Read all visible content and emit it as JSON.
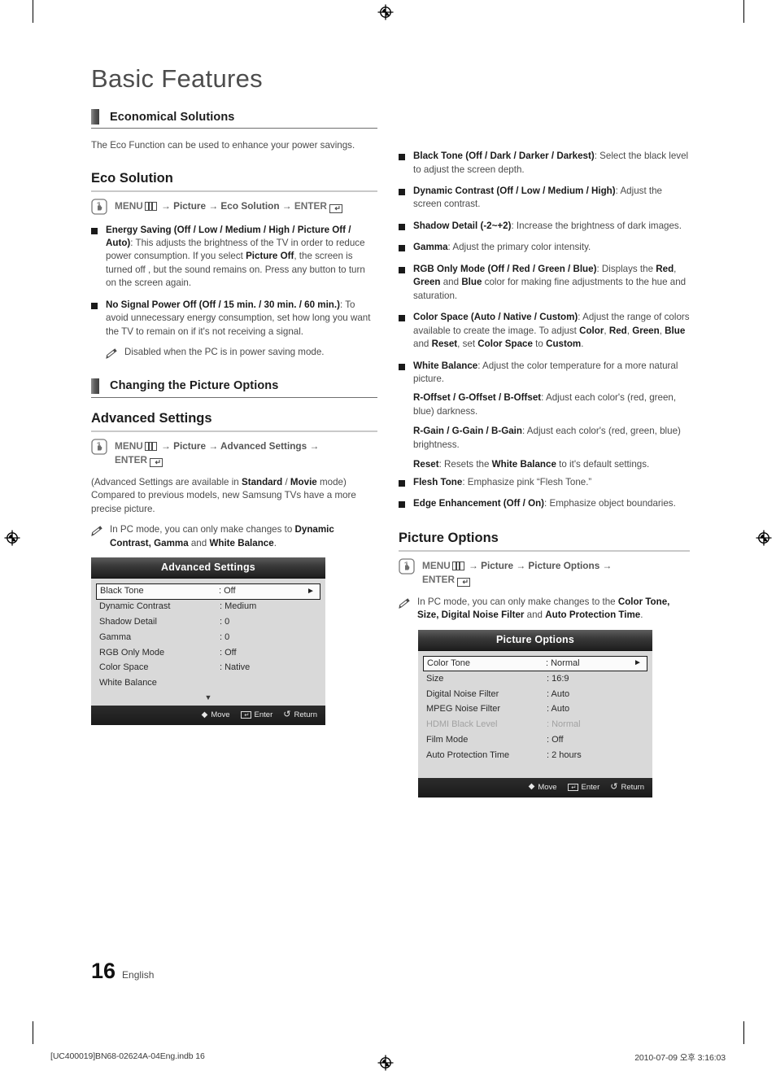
{
  "document": {
    "title": "Basic Features",
    "page_number": "16",
    "language_label": "English",
    "print_file": "[UC400019]BN68-02624A-04Eng.indb   16",
    "print_timestamp": "2010-07-09   오후 3:16:03"
  },
  "left_column": {
    "section_1": {
      "heading": "Economical Solutions",
      "intro": "The Eco Function can be used to enhance your power savings."
    },
    "eco_solution": {
      "heading": "Eco Solution",
      "menu_path_prefix": "MENU",
      "menu_path_mid": " → Picture → Eco  Solution → ",
      "menu_path_enter": "ENTER",
      "bullets": [
        {
          "term": "Energy Saving (Off / Low / Medium / High /  Picture Off / Auto)",
          "desc": ": This adjusts the brightness of the TV in order to reduce power consumption. If you select ",
          "bold_mid": "Picture Off",
          "desc2": ", the screen is turned off , but the sound remains on. Press any button to turn on the screen again."
        },
        {
          "term": "No Signal Power Off (Off / 15 min. / 30 min. / 60 min.)",
          "desc": ": To avoid unnecessary energy consumption, set how long you want the TV to remain on if it's not receiving a signal.",
          "note": "Disabled when the PC is in power saving mode."
        }
      ]
    },
    "section_2": {
      "heading": "Changing the Picture Options"
    },
    "advanced_settings": {
      "heading": "Advanced Settings",
      "menu_path_prefix": "MENU",
      "menu_path_mid": " → Picture → Advanced Settings → ",
      "menu_path_enter": "ENTER",
      "para_1_a": "(Advanced Settings are available in ",
      "para_1_b": "Standard",
      "para_1_c": " / ",
      "para_1_d": "Movie",
      "para_1_e": " mode) Compared to previous models, new Samsung TVs have a more precise picture.",
      "note_a": "In PC mode, you can only make changes to ",
      "note_b": "Dynamic Contrast, Gamma",
      "note_c": " and ",
      "note_d": "White Balance",
      "note_e": "."
    },
    "osd_advanced": {
      "title": "Advanced Settings",
      "rows": [
        {
          "label": "Black Tone",
          "value": ": Off",
          "selected": true,
          "arrow": "►"
        },
        {
          "label": "Dynamic Contrast",
          "value": ": Medium",
          "selected": false
        },
        {
          "label": "Shadow Detail",
          "value": ": 0",
          "selected": false
        },
        {
          "label": "Gamma",
          "value": ": 0",
          "selected": false
        },
        {
          "label": "RGB Only Mode",
          "value": ": Off",
          "selected": false
        },
        {
          "label": "Color Space",
          "value": ": Native",
          "selected": false
        },
        {
          "label": "White Balance",
          "value": "",
          "selected": false
        }
      ],
      "more_indicator": "▼",
      "footer": {
        "move": "Move",
        "enter": "Enter",
        "return": "Return"
      }
    }
  },
  "right_column": {
    "advanced_bullets": [
      {
        "term": "Black Tone (Off / Dark / Darker / Darkest)",
        "desc": ": Select the black level to adjust the screen depth."
      },
      {
        "term": "Dynamic Contrast (Off / Low / Medium / High)",
        "desc": ": Adjust the screen contrast."
      },
      {
        "term": "Shadow Detail (-2~+2)",
        "desc": ": Increase the brightness of dark images."
      },
      {
        "term": "Gamma",
        "desc": ": Adjust the primary color intensity."
      },
      {
        "term": "RGB Only Mode (Off / Red / Green / Blue)",
        "desc": ": Displays the Red, Green and Blue color for making fine adjustments to the hue and saturation."
      },
      {
        "term": "Color Space (Auto / Native / Custom)",
        "desc": ": Adjust the range of colors available to create the image. To adjust Color, Red, Green, Blue and Reset, set Color Space to Custom."
      },
      {
        "term": "White Balance",
        "desc": ": Adjust the color temperature for a more natural picture."
      },
      {
        "term": "Flesh Tone",
        "desc": ": Emphasize pink “Flesh Tone.”"
      },
      {
        "term": "Edge Enhancement (Off / On)",
        "desc": ": Emphasize object boundaries."
      }
    ],
    "white_balance_subs": [
      {
        "term": "R-Offset / G-Offset / B-Offset",
        "desc": ": Adjust each color's (red, green, blue) darkness."
      },
      {
        "term": "R-Gain / G-Gain / B-Gain",
        "desc": ": Adjust each color's (red, green, blue) brightness."
      },
      {
        "term": "Reset",
        "desc_a": ": Resets the ",
        "desc_b": "White Balance",
        "desc_c": " to it's default settings."
      }
    ],
    "picture_options": {
      "heading": "Picture Options",
      "menu_path_prefix": "MENU",
      "menu_path_mid": " → Picture → Picture Options → ",
      "menu_path_enter": "ENTER",
      "note_a": "In PC mode, you can only make changes to the ",
      "note_b": "Color Tone, Size, Digital Noise Filter",
      "note_c": " and ",
      "note_d": "Auto Protection Time",
      "note_e": "."
    },
    "osd_picture_options": {
      "title": "Picture Options",
      "rows": [
        {
          "label": "Color Tone",
          "value": ": Normal",
          "selected": true,
          "arrow": "►"
        },
        {
          "label": "Size",
          "value": ": 16:9",
          "selected": false
        },
        {
          "label": "Digital Noise Filter",
          "value": ": Auto",
          "selected": false
        },
        {
          "label": "MPEG Noise Filter",
          "value": ": Auto",
          "selected": false
        },
        {
          "label": "HDMI Black Level",
          "value": ": Normal",
          "selected": false,
          "disabled": true
        },
        {
          "label": "Film Mode",
          "value": ": Off",
          "selected": false
        },
        {
          "label": "Auto Protection Time",
          "value": ": 2 hours",
          "selected": false
        }
      ],
      "footer": {
        "move": "Move",
        "enter": "Enter",
        "return": "Return"
      }
    }
  }
}
